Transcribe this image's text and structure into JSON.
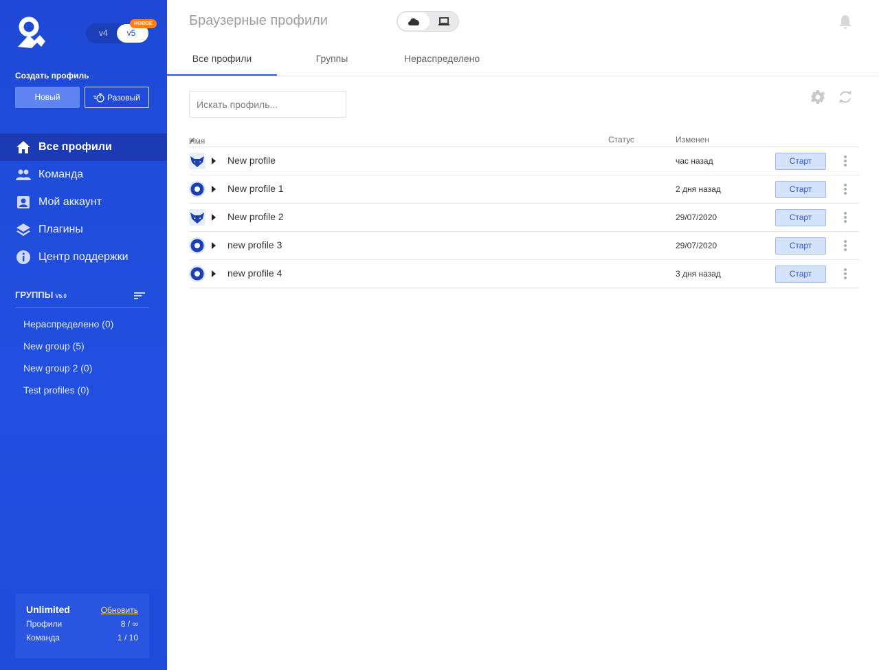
{
  "sidebar": {
    "version_toggle": {
      "v4": "v4",
      "v5": "v5",
      "badge": "НОВОЕ"
    },
    "create_label": "Создать профиль",
    "btn_new": "Новый",
    "btn_once": "Разовый",
    "nav": [
      {
        "label": "Все профили",
        "icon": "home-icon",
        "active": true
      },
      {
        "label": "Команда",
        "icon": "team-icon",
        "active": false
      },
      {
        "label": "Мой аккаунт",
        "icon": "account-icon",
        "active": false
      },
      {
        "label": "Плагины",
        "icon": "layers-icon",
        "active": false
      },
      {
        "label": "Центр поддержки",
        "icon": "info-icon",
        "active": false
      }
    ],
    "groups": {
      "title": "ГРУППЫ",
      "version": "V5.0",
      "items": [
        {
          "label": "Нераспределено  (0)"
        },
        {
          "label": "New group  (5)"
        },
        {
          "label": "New group 2  (0)"
        },
        {
          "label": "Test profiles  (0)"
        }
      ]
    },
    "plan": {
      "name": "Unlimited",
      "update_link": "Обновить",
      "rows": [
        {
          "label": "Профили",
          "value": "8 / ∞"
        },
        {
          "label": "Команда",
          "value": "1 / 10"
        }
      ]
    }
  },
  "header": {
    "title": "Браузерные профили"
  },
  "tabs": [
    {
      "label": "Все профили",
      "active": true
    },
    {
      "label": "Группы",
      "active": false
    },
    {
      "label": "Нераспределено",
      "active": false
    }
  ],
  "search": {
    "placeholder": "Искать профиль..."
  },
  "table": {
    "columns": {
      "name": "Имя",
      "status": "Статус",
      "modified": "Изменен"
    },
    "start_label": "Старт",
    "rows": [
      {
        "browser": "fox-icon",
        "name": "New profile",
        "status": "",
        "modified": "час назад"
      },
      {
        "browser": "orbita-icon",
        "name": "New profile 1",
        "status": "",
        "modified": "2 дня назад"
      },
      {
        "browser": "fox-icon",
        "name": "New profile 2",
        "status": "",
        "modified": "29/07/2020"
      },
      {
        "browser": "orbita-icon",
        "name": "new profile 3",
        "status": "",
        "modified": "29/07/2020"
      },
      {
        "browser": "orbita-icon",
        "name": "new profile 4",
        "status": "",
        "modified": "3 дня назад"
      }
    ]
  },
  "colors": {
    "sidebar": "#1f49d6",
    "accent": "#2a57e0",
    "badge": "#ff7f1a",
    "start_bg": "#d5e2fb"
  }
}
